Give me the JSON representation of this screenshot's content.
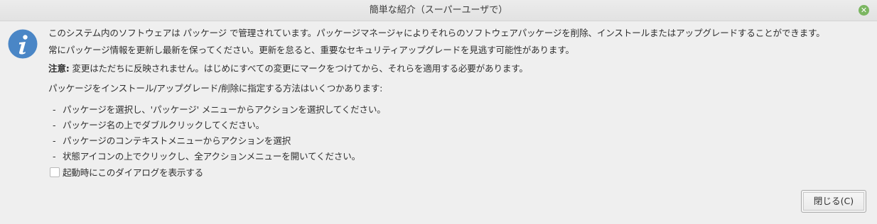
{
  "window": {
    "title": "簡単な紹介（スーパーユーザで）"
  },
  "colors": {
    "close_button": "#7bb661",
    "info_icon": "#4a86c6"
  },
  "icons": {
    "close": "close-icon",
    "info": "info-icon"
  },
  "content": {
    "paragraph1": "このシステム内のソフトウェアは パッケージ で管理されています。パッケージマネージャによりそれらのソフトウェアパッケージを削除、インストールまたはアップグレードすることができます。",
    "paragraph2": "常にパッケージ情報を更新し最新を保ってください。更新を怠ると、重要なセキュリティアップグレードを見逃す可能性があります。",
    "note_label": "注意:",
    "note_text": " 変更はただちに反映されません。はじめにすべての変更にマークをつけてから、それらを適用する必要があります。",
    "methods_intro": "パッケージをインストール/アップグレード/削除に指定する方法はいくつかあります:",
    "methods": [
      "パッケージを選択し、'パッケージ' メニューからアクションを選択してください。",
      "パッケージ名の上でダブルクリックしてください。",
      "パッケージのコンテキストメニューからアクションを選択",
      "状態アイコンの上でクリックし、全アクションメニューを開いてください。"
    ],
    "bullet": "-"
  },
  "checkbox": {
    "label": "起動時にこのダイアログを表示する",
    "checked": false
  },
  "buttons": {
    "close_label": "閉じる(C)"
  }
}
